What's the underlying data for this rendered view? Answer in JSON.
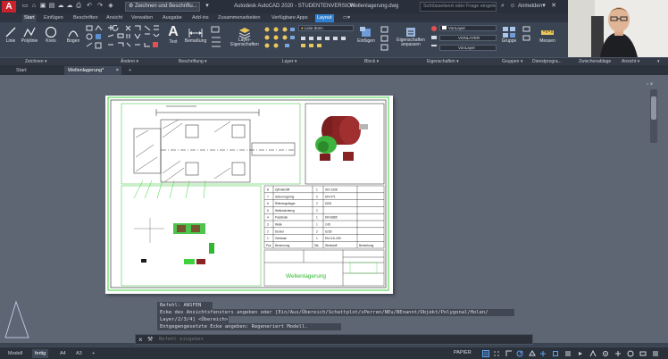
{
  "titlebar": {
    "logo": "A",
    "workspace": "Zeichnen und Beschriftu...",
    "app_title": "Autodesk AutoCAD 2020 - STUDENTENVERSION",
    "filename": "Wellenlagerung.dwg",
    "search_placeholder": "Schlüsselwort oder Frage eingeben",
    "login": "Anmelden"
  },
  "ribbon_tabs": [
    "Start",
    "Einfügen",
    "Beschriften",
    "Ansicht",
    "Verwalten",
    "Ausgabe",
    "Add-ins",
    "Zusammenarbeiten",
    "Verfügbare Apps",
    "Layout"
  ],
  "ribbon": {
    "draw_tools": [
      "Linie",
      "Polylinie",
      "Kreis",
      "Bogen"
    ],
    "text_label": "Text",
    "dim_label": "Bemaßung",
    "layer_props": "Layer-\nEigenschaften",
    "layer_combo": "Linie dünn",
    "insert_label": "Einfügen",
    "props_match": "Eigenschaften\nanpassen",
    "prop_combo_color": "VonLayer",
    "prop_combo_lineweight": "VONLAYER",
    "prop_combo_linetype": "VonLayer",
    "group_label": "Gruppe",
    "measure_label": "Messen"
  },
  "group_labels": [
    "Zeichnen ▾",
    "Ändern ▾",
    "Beschriftung ▾",
    "Layer ▾",
    "Block ▾",
    "Eigenschaften ▾",
    "Gruppen ▾",
    "Dienstprogra...",
    "Zwischenablage",
    "Ansicht ▾"
  ],
  "doc_tabs": [
    "Start",
    "Wellenlagerung*",
    "+"
  ],
  "title_block": {
    "title": "Wellenlagerung",
    "bom_header": [
      "Pos",
      "Benennung",
      "Stk",
      "Werkstoff",
      "Bemerkung"
    ],
    "bom_rows": [
      [
        "8",
        "Zylinderstift",
        "1",
        "ISO 2338",
        ""
      ],
      [
        "7",
        "Sicherungsring",
        "2",
        "DIN 471",
        ""
      ],
      [
        "6",
        "Rillenkugellager",
        "2",
        "6206",
        ""
      ],
      [
        "5",
        "Wellendichtring",
        "2",
        "",
        ""
      ],
      [
        "4",
        "Passfeder",
        "1",
        "DIN 6885",
        ""
      ],
      [
        "3",
        "Welle",
        "1",
        "C45",
        ""
      ],
      [
        "2",
        "Deckel",
        "2",
        "S235",
        ""
      ],
      [
        "1",
        "Gehäuse",
        "1",
        "EN-GJL-250",
        ""
      ]
    ]
  },
  "command": {
    "history": [
      "Befehl: ANSFEN",
      "Ecke des Ansichtsfensters angeben oder [Ein/Aus/Übereich/Schattplot/sPerren/NEu/BEnannt/Objekt/Polygonal/Holen/",
      "Layer/2/3/4] <Übereich>:",
      "Entgegengesetzte Ecke angeben: Regeneriert Modell."
    ],
    "placeholder": "Befehl eingeben"
  },
  "status": {
    "layouts": [
      "Modell",
      "fertig",
      "A4",
      "A3",
      "+"
    ],
    "paper": "PAPIER"
  },
  "colors": {
    "accent": "#2f7fd0",
    "brand_red": "#c8232c",
    "viewport_border": "#3fd23f",
    "part_red": "#8a2323",
    "part_green": "#3cb33c"
  }
}
